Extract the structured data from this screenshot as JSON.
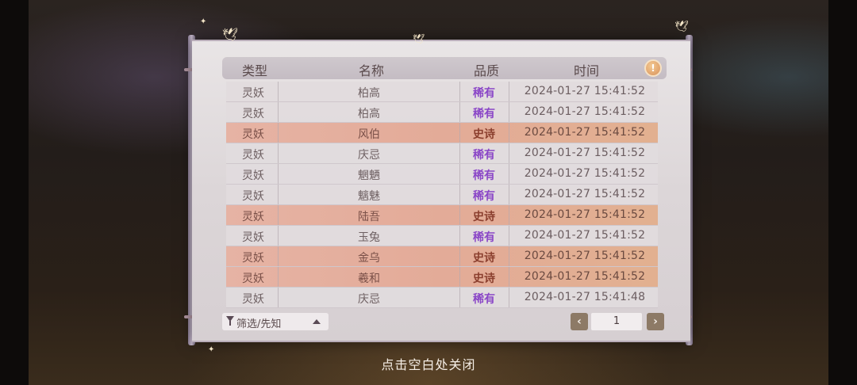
{
  "table": {
    "headers": [
      "类型",
      "名称",
      "品质",
      "时间"
    ],
    "rows": [
      {
        "type": "灵妖",
        "name": "柏高",
        "quality": "稀有",
        "time": "2024-01-27  15:41:52",
        "epic": false
      },
      {
        "type": "灵妖",
        "name": "柏高",
        "quality": "稀有",
        "time": "2024-01-27  15:41:52",
        "epic": false
      },
      {
        "type": "灵妖",
        "name": "风伯",
        "quality": "史诗",
        "time": "2024-01-27  15:41:52",
        "epic": true
      },
      {
        "type": "灵妖",
        "name": "庆忌",
        "quality": "稀有",
        "time": "2024-01-27  15:41:52",
        "epic": false
      },
      {
        "type": "灵妖",
        "name": "魍魉",
        "quality": "稀有",
        "time": "2024-01-27  15:41:52",
        "epic": false
      },
      {
        "type": "灵妖",
        "name": "魑魅",
        "quality": "稀有",
        "time": "2024-01-27  15:41:52",
        "epic": false
      },
      {
        "type": "灵妖",
        "name": "陆吾",
        "quality": "史诗",
        "time": "2024-01-27  15:41:52",
        "epic": true
      },
      {
        "type": "灵妖",
        "name": "玉兔",
        "quality": "稀有",
        "time": "2024-01-27  15:41:52",
        "epic": false
      },
      {
        "type": "灵妖",
        "name": "金乌",
        "quality": "史诗",
        "time": "2024-01-27  15:41:52",
        "epic": true
      },
      {
        "type": "灵妖",
        "name": "羲和",
        "quality": "史诗",
        "time": "2024-01-27  15:41:52",
        "epic": true
      },
      {
        "type": "灵妖",
        "name": "庆忌",
        "quality": "稀有",
        "time": "2024-01-27  15:41:48",
        "epic": false
      }
    ]
  },
  "alert_icon": "!",
  "filter": {
    "label": "筛选/先知",
    "icon": "filter-icon"
  },
  "pager": {
    "prev": "‹",
    "next": "›",
    "page": "1"
  },
  "close_hint": "点击空白处关闭",
  "colors": {
    "rare": "#8a46c7",
    "epic_row": "#e3ab98",
    "accent": "#d9925a"
  }
}
